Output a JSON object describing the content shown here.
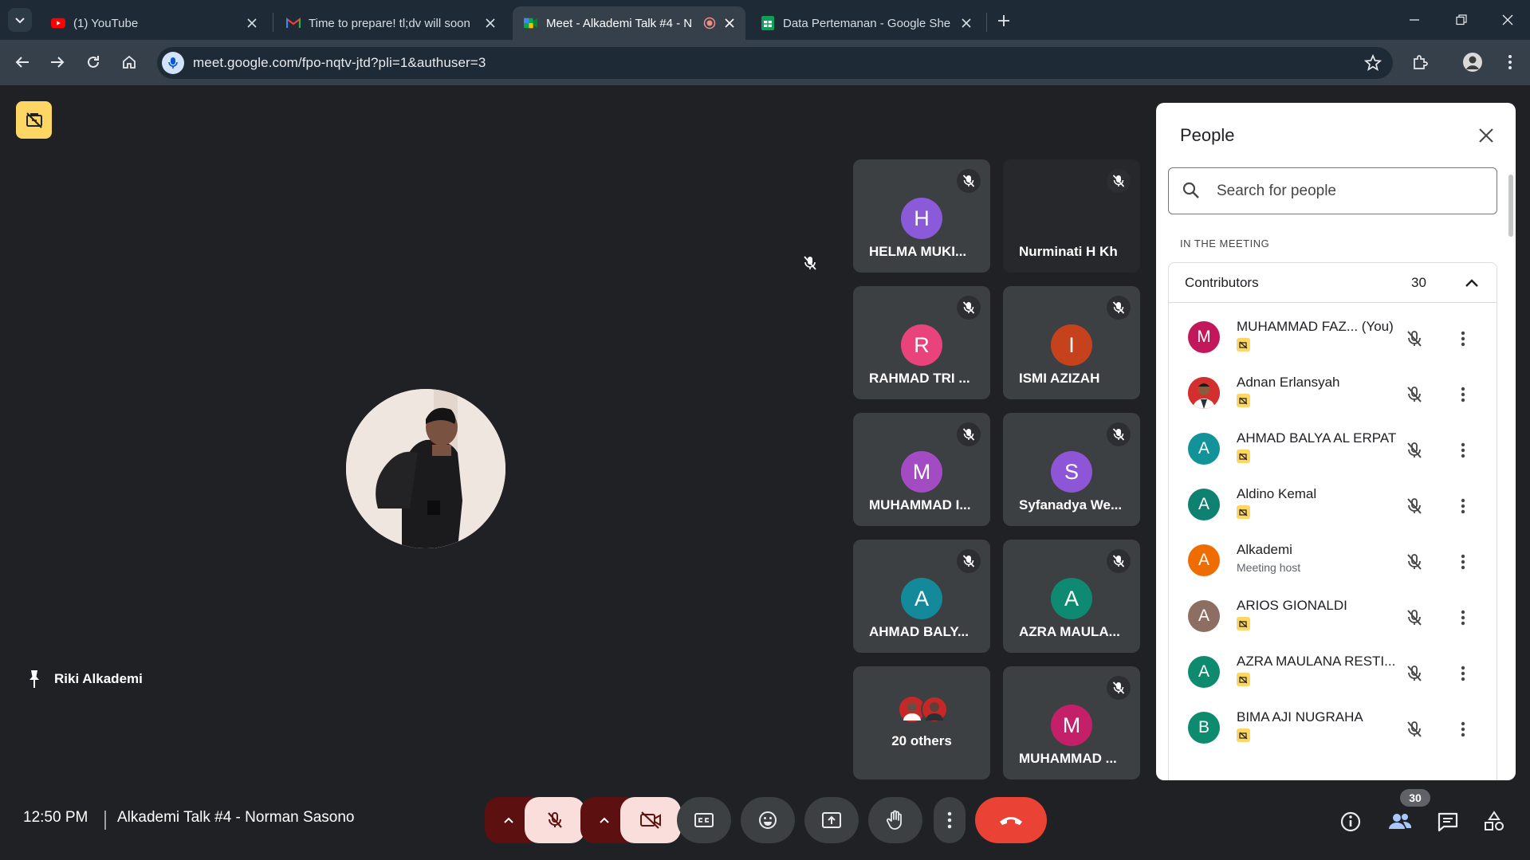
{
  "browser": {
    "tabs": [
      {
        "title": "(1) YouTube",
        "icon": "youtube-icon"
      },
      {
        "title": "Time to prepare! tl;dv will soon",
        "icon": "gmail-icon"
      },
      {
        "title": "Meet - Alkademi Talk #4 - N",
        "icon": "meet-icon"
      },
      {
        "title": "Data Pertemanan - Google She",
        "icon": "sheets-icon"
      }
    ],
    "url": "meet.google.com/fpo-nqtv-jtd?pli=1&authuser=3"
  },
  "meet": {
    "pinned_name": "Riki Alkademi",
    "tiles": [
      {
        "name": "HELMA MUKI...",
        "initial": "H",
        "color": "#8b5ad8"
      },
      {
        "name": "Nurminati H Kh",
        "initial": "",
        "color": ""
      },
      {
        "name": "RAHMAD TRI ...",
        "initial": "R",
        "color": "#e8437a"
      },
      {
        "name": "ISMI AZIZAH",
        "initial": "I",
        "color": "#c5421c"
      },
      {
        "name": "MUHAMMAD I...",
        "initial": "M",
        "color": "#a34bc3"
      },
      {
        "name": "Syfanadya We...",
        "initial": "S",
        "color": "#8e56d6"
      },
      {
        "name": "AHMAD BALY...",
        "initial": "A",
        "color": "#13899a"
      },
      {
        "name": "AZRA MAULA...",
        "initial": "A",
        "color": "#0e8a73"
      },
      {
        "name": "20 others",
        "initial": "",
        "color": ""
      },
      {
        "name": "MUHAMMAD ...",
        "initial": "M",
        "color": "#c4206a"
      }
    ],
    "time": "12:50 PM",
    "meeting_title": "Alkademi Talk #4 - Norman Sasono",
    "people_count": "30"
  },
  "panel": {
    "title": "People",
    "search_placeholder": "Search for people",
    "section_label": "IN THE MEETING",
    "group_label": "Contributors",
    "group_count": "30",
    "participants": [
      {
        "name": "MUHAMMAD FAZ...   (You)",
        "initial": "M",
        "color": "#c2185b",
        "sub": ""
      },
      {
        "name": "Adnan Erlansyah",
        "initial": "",
        "color": "#d32f2f",
        "sub": ""
      },
      {
        "name": "AHMAD BALYA AL ERPAT",
        "initial": "A",
        "color": "#12939a",
        "sub": ""
      },
      {
        "name": "Aldino Kemal",
        "initial": "A",
        "color": "#0e8170",
        "sub": ""
      },
      {
        "name": "Alkademi",
        "initial": "A",
        "color": "#ef6c00",
        "sub": "Meeting host"
      },
      {
        "name": "ARIOS GIONALDI",
        "initial": "A",
        "color": "#8d6e63",
        "sub": ""
      },
      {
        "name": "AZRA MAULANA RESTI...",
        "initial": "A",
        "color": "#0e8a6e",
        "sub": ""
      },
      {
        "name": "BIMA AJI NUGRAHA",
        "initial": "B",
        "color": "#0e8a6e",
        "sub": ""
      }
    ]
  },
  "colors": {
    "accent_yellow": "#fdd663",
    "end_call": "#ea4335",
    "muted_bg": "#f9dedc"
  }
}
